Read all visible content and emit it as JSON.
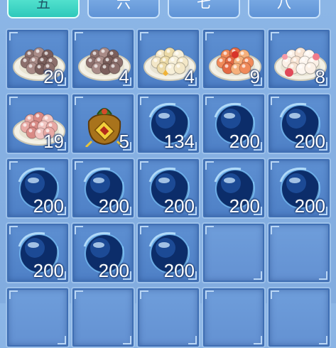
{
  "tabs": [
    {
      "label": "五",
      "active": true
    },
    {
      "label": "六",
      "active": false
    },
    {
      "label": "七",
      "active": false
    },
    {
      "label": "八",
      "active": false
    }
  ],
  "slots": [
    {
      "item": "brown-dumpling-plate",
      "count": "20"
    },
    {
      "item": "brown-dumpling-plate",
      "count": "4"
    },
    {
      "item": "cream-dumpling-plate",
      "count": "4"
    },
    {
      "item": "red-dumpling-plate",
      "count": "9"
    },
    {
      "item": "flower-dumpling-plate",
      "count": "8"
    },
    {
      "item": "pink-dumpling-plate",
      "count": "19"
    },
    {
      "item": "lucky-pouch",
      "count": "5"
    },
    {
      "item": "blue-orb",
      "count": "134"
    },
    {
      "item": "blue-orb",
      "count": "200"
    },
    {
      "item": "blue-orb",
      "count": "200"
    },
    {
      "item": "blue-orb",
      "count": "200"
    },
    {
      "item": "blue-orb",
      "count": "200"
    },
    {
      "item": "blue-orb",
      "count": "200"
    },
    {
      "item": "blue-orb",
      "count": "200"
    },
    {
      "item": "blue-orb",
      "count": "200"
    },
    {
      "item": "blue-orb",
      "count": "200"
    },
    {
      "item": "blue-orb",
      "count": "200"
    },
    {
      "item": "blue-orb",
      "count": "200"
    },
    {
      "item": "empty",
      "count": ""
    },
    {
      "item": "empty",
      "count": ""
    },
    {
      "item": "empty",
      "count": ""
    },
    {
      "item": "empty",
      "count": ""
    },
    {
      "item": "empty",
      "count": ""
    },
    {
      "item": "empty",
      "count": ""
    },
    {
      "item": "empty",
      "count": ""
    }
  ]
}
